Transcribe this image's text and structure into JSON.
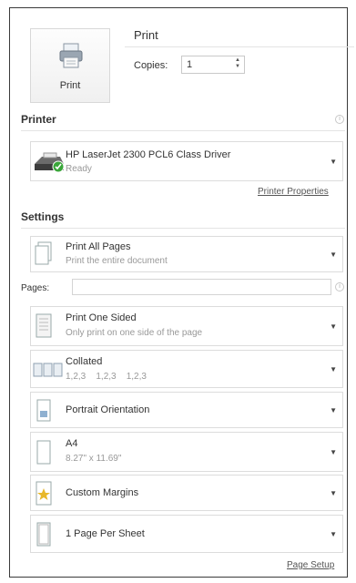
{
  "print": {
    "button_label": "Print",
    "title": "Print",
    "copies_label": "Copies:",
    "copies_value": "1"
  },
  "printer": {
    "heading": "Printer",
    "name": "HP LaserJet 2300 PCL6 Class Driver",
    "status": "Ready",
    "properties_link": "Printer Properties"
  },
  "settings": {
    "heading": "Settings",
    "pages_label": "Pages:",
    "pages_value": "",
    "items": [
      {
        "main": "Print All Pages",
        "sub": "Print the entire document"
      },
      {
        "main": "Print One Sided",
        "sub": "Only print on one side of the page"
      },
      {
        "main": "Collated",
        "sub": "1,2,3    1,2,3    1,2,3"
      },
      {
        "main": "Portrait Orientation",
        "sub": ""
      },
      {
        "main": "A4",
        "sub": "8.27\" x 11.69\""
      },
      {
        "main": "Custom Margins",
        "sub": ""
      },
      {
        "main": "1 Page Per Sheet",
        "sub": ""
      }
    ],
    "page_setup_link": "Page Setup"
  },
  "colors": {
    "ready_check": "#3aa63a",
    "margin_star": "#e8b82a"
  },
  "icons": [
    "printer-icon",
    "info-icon",
    "dropdown-arrow-icon",
    "ready-check-icon",
    "document-icon",
    "margins-icon"
  ]
}
